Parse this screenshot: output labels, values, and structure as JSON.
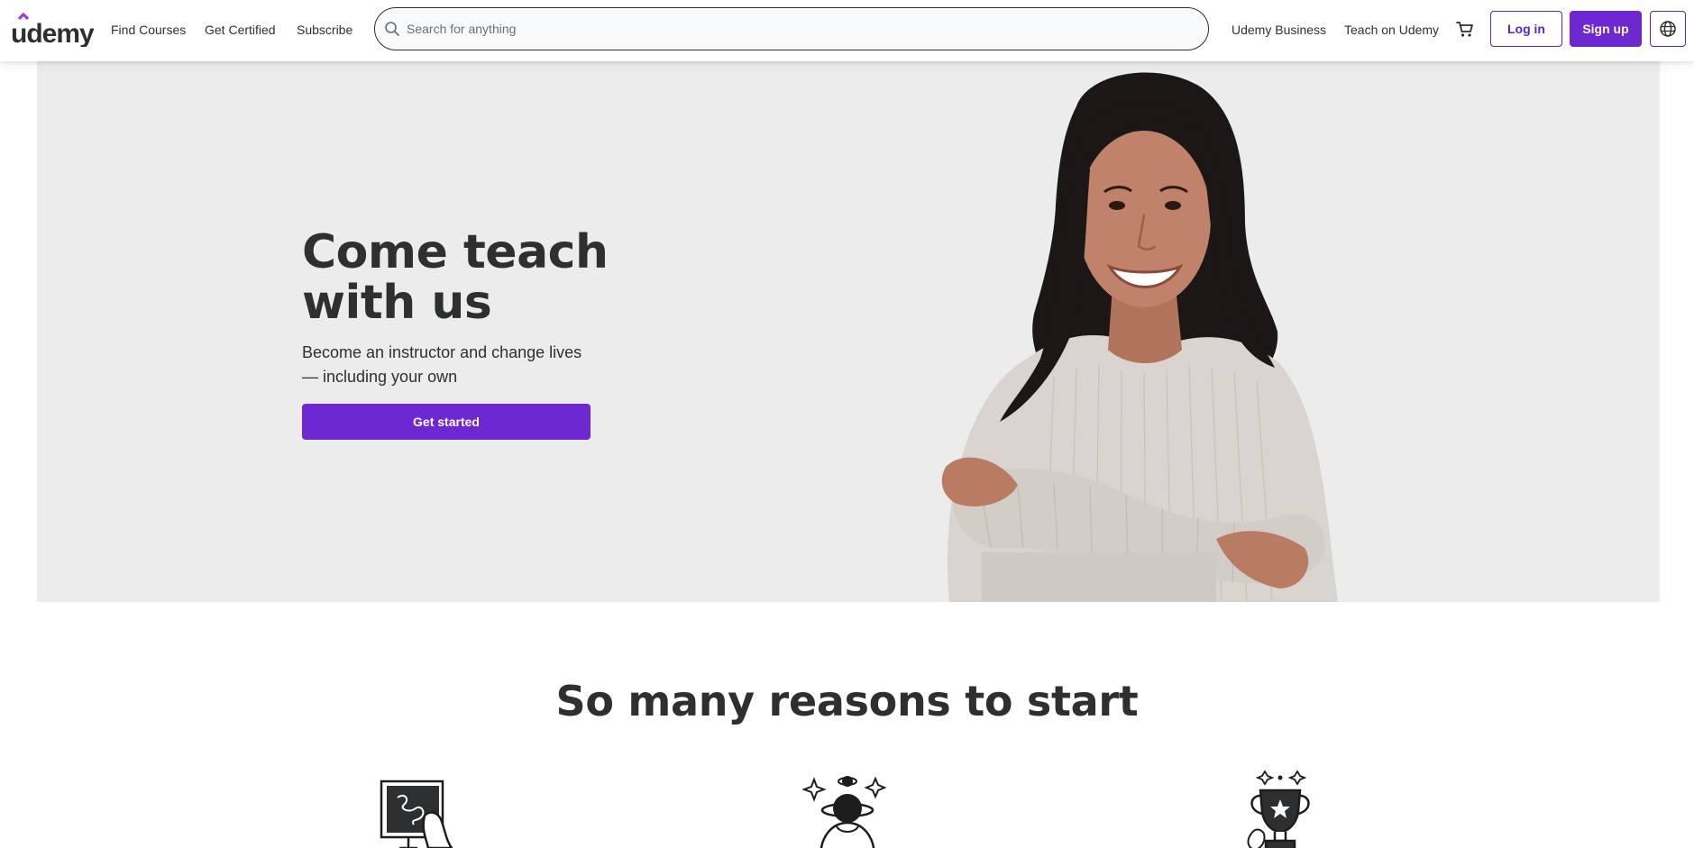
{
  "header": {
    "logo_text": "udemy",
    "nav_left": [
      "Find Courses",
      "Get Certified",
      "Subscribe"
    ],
    "search": {
      "placeholder": "Search for anything",
      "value": ""
    },
    "nav_right": [
      "Udemy Business",
      "Teach on Udemy"
    ],
    "login_label": "Log in",
    "signup_label": "Sign up",
    "icons": {
      "search": "search-icon",
      "cart": "shopping-cart-icon",
      "language": "globe-icon"
    }
  },
  "hero": {
    "title_line1": "Come teach",
    "title_line2": "with us",
    "subtitle_line1": "Become an instructor and change lives",
    "subtitle_line2": "— including your own",
    "cta_label": "Get started"
  },
  "reasons": {
    "title": "So many reasons to start",
    "illustrations": [
      "teaching-board-illustration",
      "planet-person-illustration",
      "trophy-illustration"
    ]
  },
  "colors": {
    "brand_purple": "#6d28d2",
    "text_dark": "#2d2f31",
    "hero_bg": "#ececec"
  }
}
